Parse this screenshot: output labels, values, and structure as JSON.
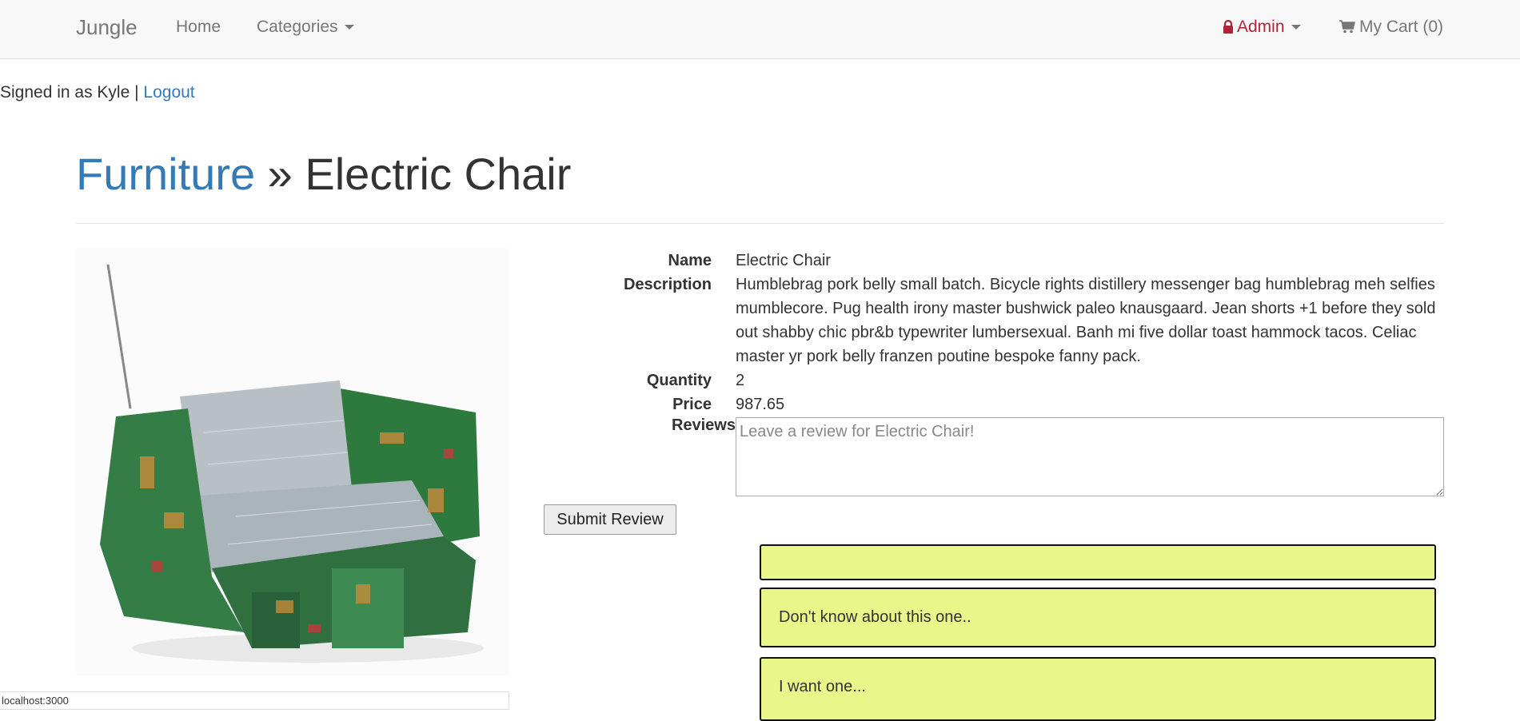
{
  "navbar": {
    "brand": "Jungle",
    "home": "Home",
    "categories": "Categories",
    "admin": "Admin",
    "cart": "My Cart (0)",
    "icons": {
      "lock": "lock-icon",
      "cart": "shopping-cart-icon"
    },
    "colors": {
      "admin": "#b2233a",
      "background": "#f8f8f8"
    }
  },
  "session": {
    "signed_in_text": "Signed in as Kyle |",
    "logout": "Logout"
  },
  "breadcrumb": {
    "category": "Furniture",
    "separator": "»",
    "product": "Electric Chair"
  },
  "product": {
    "name_label": "Name",
    "name": "Electric Chair",
    "description_label": "Description",
    "description": "Humblebrag pork belly small batch. Bicycle rights distillery messenger bag humblebrag meh selfies mumblecore. Pug health irony master bushwick paleo knausgaard. Jean shorts +1 before they sold out shabby chic pbr&b typewriter lumbersexual. Banh mi five dollar toast hammock tacos. Celiac master yr pork belly franzen poutine bespoke fanny pack.",
    "quantity_label": "Quantity",
    "quantity": "2",
    "price_label": "Price",
    "price": "987.65"
  },
  "review_form": {
    "label": "Reviews",
    "placeholder": "Leave a review for Electric Chair!",
    "submit": "Submit Review"
  },
  "reviews": [
    {
      "text": ""
    },
    {
      "text": "Don't know about this one.."
    },
    {
      "text": "I want one..."
    }
  ],
  "review_card_color": "#e9f78a",
  "status_bar": "localhost:3000"
}
